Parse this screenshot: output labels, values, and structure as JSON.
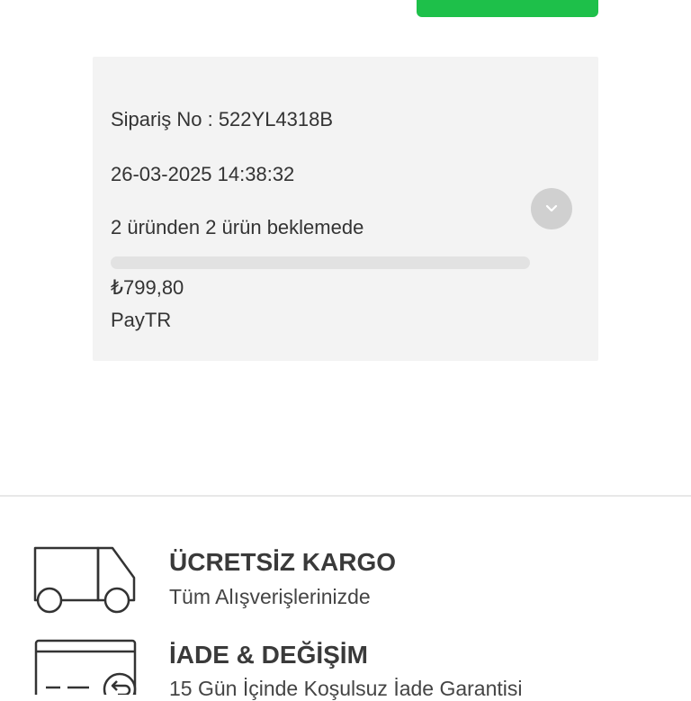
{
  "order": {
    "number_label": "Sipariş No : 522YL4318B",
    "datetime": "26-03-2025 14:38:32",
    "status": "2 üründen 2 ürün beklemede",
    "progress_fraction": 0,
    "amount": "₺799,80",
    "payment_method": "PayTR",
    "expand_icon": "chevron-down-icon"
  },
  "features": [
    {
      "icon": "truck-icon",
      "title": "ÜCRETSİZ KARGO",
      "subtitle": "Tüm Alışverişlerinizde"
    },
    {
      "icon": "card-return-icon",
      "title": "İADE & DEĞİŞİM",
      "subtitle": "15 Gün İçinde Koşulsuz İade Garantisi"
    }
  ],
  "colors": {
    "accent_green": "#1ec04a",
    "card_bg": "#f3f3f3",
    "expand_button": "#d0d0d0"
  }
}
